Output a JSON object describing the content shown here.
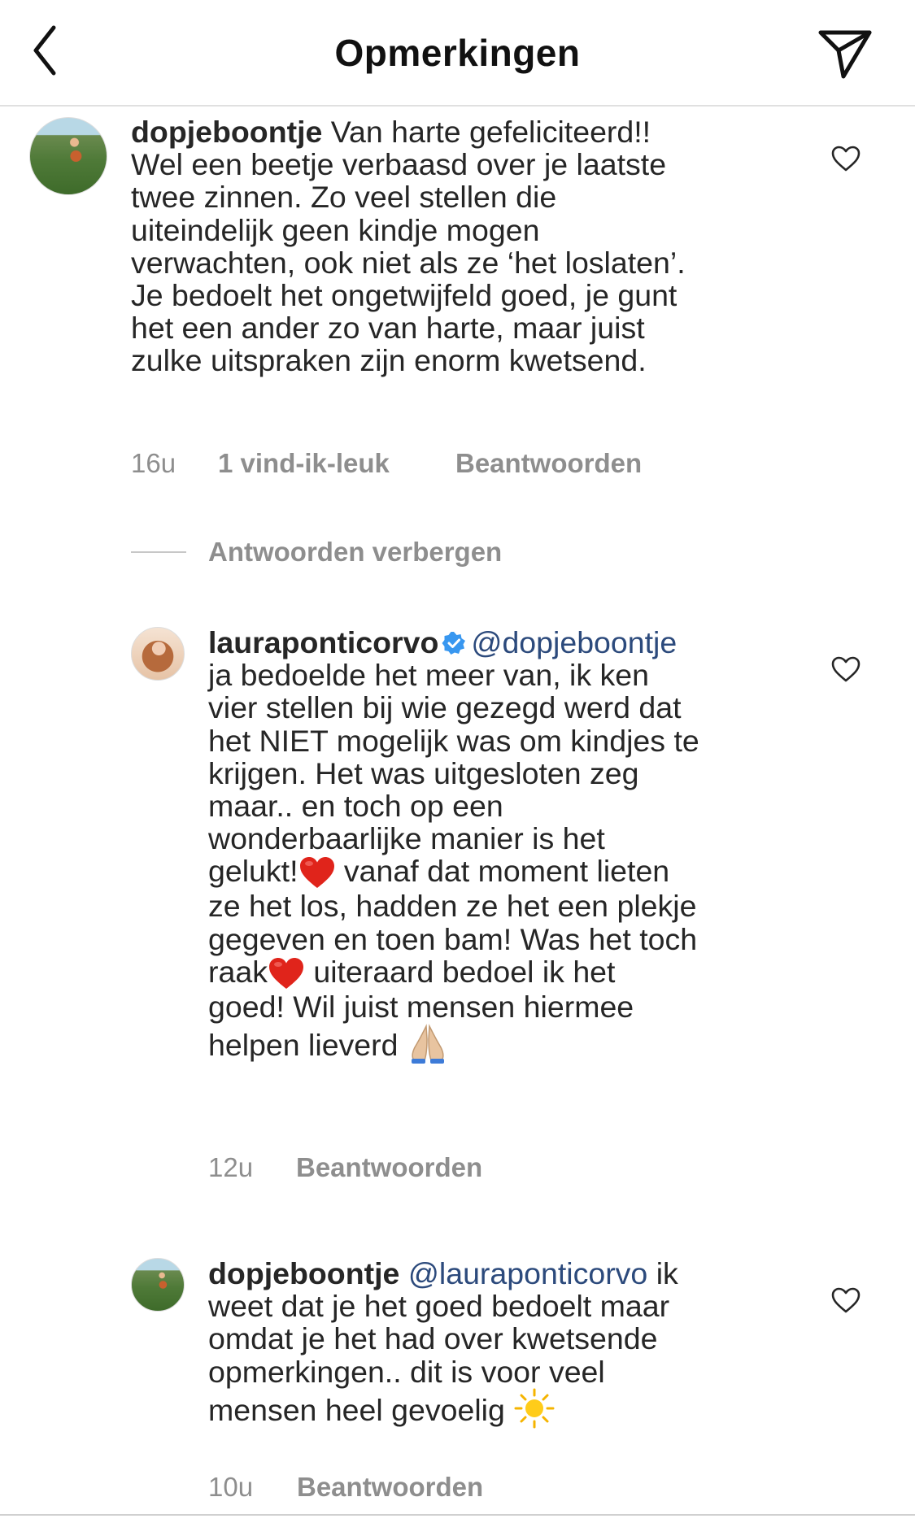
{
  "header": {
    "title": "Opmerkingen",
    "back_icon": "chevron-left-icon",
    "share_icon": "paper-plane-icon"
  },
  "comments": [
    {
      "username": "dopjeboontje",
      "body": " Van harte gefeliciteerd!!\nWel een beetje verbaasd over je laatste\ntwee zinnen. Zo veel stellen die\nuiteindelijk geen kindje mogen\nverwachten, ook niet als ze ‘het loslaten’.\nJe bedoelt het ongetwijfeld goed, je gunt\nhet een ander zo van harte, maar juist\nzulke uitspraken zijn enorm kwetsend.",
      "time": "16u",
      "likes": "1 vind-ik-leuk",
      "reply": "Beantwoorden"
    },
    {
      "username": "lauraponticorvo",
      "mention": "@dopjeboontje",
      "body_1": "ja bedoelde het meer van, ik ken\nvier stellen bij wie gezegd werd dat\nhet NIET mogelijk was om kindjes te\nkrijgen. Het was uitgesloten zeg\nmaar.. en toch op een\nwonderbaarlijke manier is het\ngelukt!",
      "body_2": " vanaf dat moment lieten\nze het los, hadden ze het een plekje\ngegeven en toen bam! Was het toch\nraak",
      "body_3": " uiteraard bedoel ik het\ngoed! Wil juist mensen hiermee\nhelpen lieverd ",
      "time": "12u",
      "reply": "Beantwoorden"
    },
    {
      "username": "dopjeboontje",
      "mention": "@lauraponticorvo",
      "body_1": " ik\nweet dat je het goed bedoelt maar\nomdat je het had over kwetsende\nopmerkingen.. dit is voor veel\nmensen heel gevoelig ",
      "time": "10u",
      "reply": "Beantwoorden"
    }
  ],
  "hide_replies": "Antwoorden verbergen",
  "icons": {
    "heart": "heart-outline-icon",
    "verified": "verified-badge-icon",
    "emoji_heart": "red-heart-emoji",
    "emoji_pray": "folded-hands-emoji",
    "emoji_sun": "sun-emoji"
  },
  "colors": {
    "mention": "#2c4a7c",
    "verified": "#3897f0",
    "meta": "#8e8e8e"
  }
}
